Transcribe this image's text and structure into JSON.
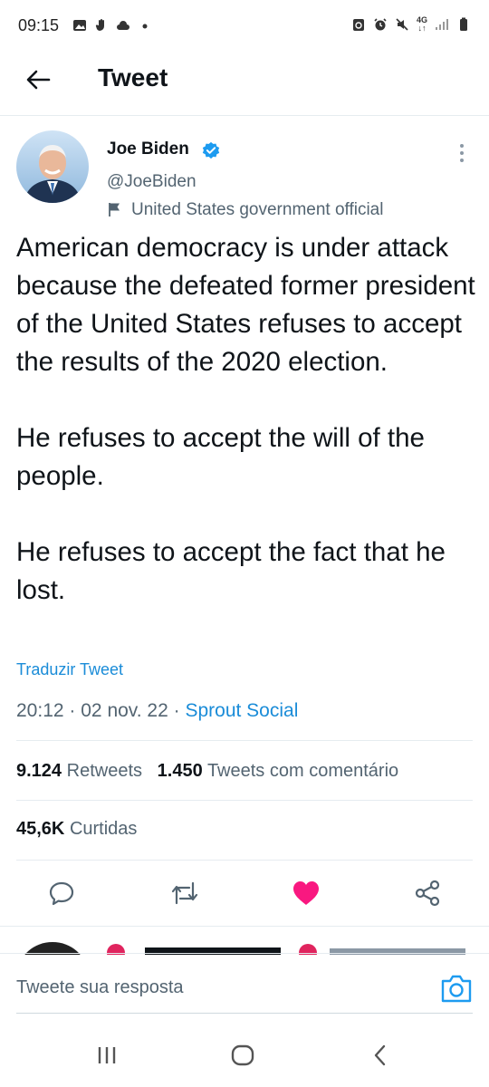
{
  "status_bar": {
    "time": "09:15",
    "left_icons": [
      "image-icon",
      "hand-icon",
      "cloud-icon",
      "dot-icon"
    ],
    "right_icons": [
      "recycle-icon",
      "alarm-icon",
      "mute-icon",
      "4g-icon",
      "signal-icon",
      "battery-icon"
    ],
    "network": "4G"
  },
  "header": {
    "title": "Tweet"
  },
  "tweet": {
    "author_name": "Joe Biden",
    "author_handle": "@JoeBiden",
    "label": "United States government official",
    "text": "American democracy is under attack because the defeated former president of the United States refuses to accept the results of the 2020 election.\n\nHe refuses to accept the will of the people.\n\nHe refuses to accept the fact that he lost.",
    "translate": "Traduzir Tweet",
    "time": "20:12",
    "date": "02 nov. 22",
    "source": "Sprout Social",
    "separator": "·",
    "retweets_count": "9.124",
    "retweets_label": "Retweets",
    "quotes_count": "1.450",
    "quotes_label": "Tweets com comentário",
    "likes_count": "45,6K",
    "likes_label": "Curtidas"
  },
  "actions": {
    "reply_icon": "reply-icon",
    "retweet_icon": "retweet-icon",
    "like_icon": "heart-icon",
    "share_icon": "share-icon",
    "like_color": "#f91880"
  },
  "reply": {
    "placeholder": "Tweete sua resposta"
  },
  "colors": {
    "link": "#1a8cd8",
    "secondary_text": "#536471",
    "primary_text": "#0f1419",
    "verified": "#1d9bf0"
  }
}
